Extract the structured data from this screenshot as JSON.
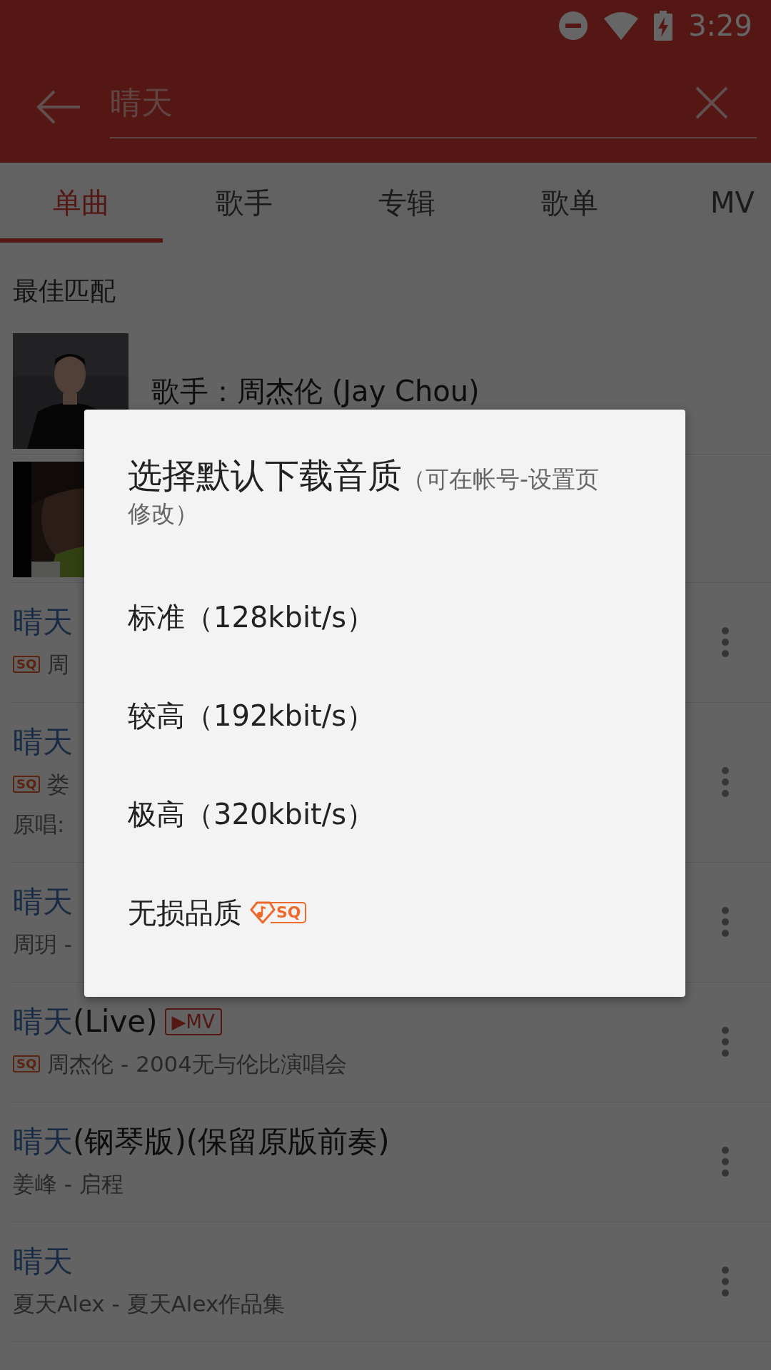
{
  "status_bar": {
    "time": "3:29"
  },
  "search": {
    "value": "晴天"
  },
  "tabs": [
    {
      "label": "单曲",
      "selected": true
    },
    {
      "label": "歌手",
      "selected": false
    },
    {
      "label": "专辑",
      "selected": false
    },
    {
      "label": "歌单",
      "selected": false
    },
    {
      "label": "MV",
      "selected": false
    }
  ],
  "best_match": {
    "heading": "最佳匹配",
    "items": [
      {
        "kind": "picture",
        "label": "歌手：周杰伦 (Jay Chou)"
      },
      {
        "kind": "picture"
      }
    ]
  },
  "songs": [
    {
      "title_highlight": "晴天",
      "sq_badge": "SQ",
      "subtitle": "周",
      "menu": true
    },
    {
      "title_highlight": "晴天",
      "sq_badge": "SQ",
      "subtitle": "娄",
      "extra_line": "原唱:",
      "menu": true
    },
    {
      "title_highlight": "晴天",
      "subtitle": "周玥 -",
      "menu": true
    },
    {
      "title_highlight": "晴天",
      "title_rest": "(Live)",
      "mv_badge": "▶MV",
      "sq_badge": "SQ",
      "subtitle": "周杰伦 - 2004无与伦比演唱会",
      "menu": true
    },
    {
      "title_highlight": "晴天",
      "title_rest": "(钢琴版)(保留原版前奏)",
      "subtitle": "姜峰 - 启程",
      "menu": true
    },
    {
      "title_highlight": "晴天",
      "subtitle": "夏天Alex - 夏天Alex作品集",
      "menu": true
    }
  ],
  "dialog": {
    "title": "选择默认下载音质",
    "hint": "（可在帐号-设置页修改）",
    "options": [
      {
        "label": "标准（128kbit/s）"
      },
      {
        "label": "较高（192kbit/s）"
      },
      {
        "label": "极高（320kbit/s）"
      },
      {
        "label": "无损品质",
        "badge": "SQ"
      }
    ]
  }
}
